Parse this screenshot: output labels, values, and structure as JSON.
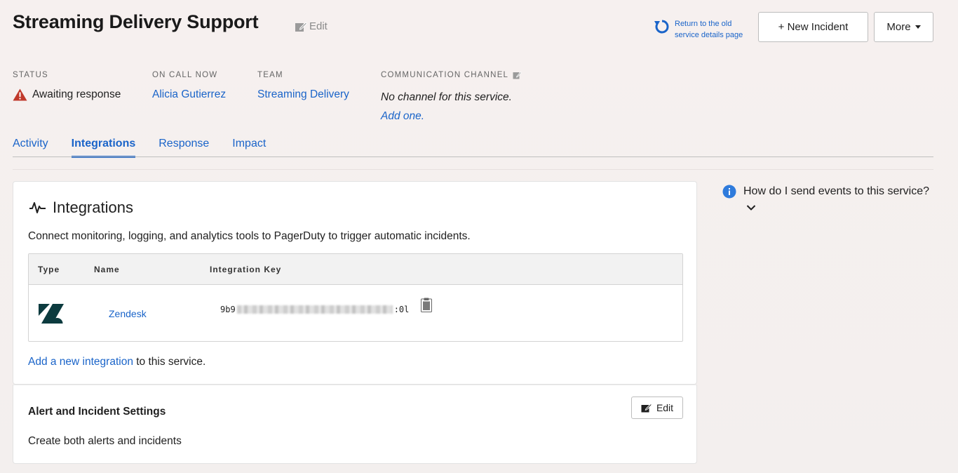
{
  "header": {
    "title": "Streaming Delivery Support",
    "edit_label": "Edit",
    "return_link_line1": "Return to the old",
    "return_link_line2": "service details page",
    "new_incident_label": "+ New Incident",
    "more_label": "More"
  },
  "meta": {
    "status_label": "STATUS",
    "status_value": "Awaiting response",
    "on_call_label": "ON CALL NOW",
    "on_call_value": "Alicia Gutierrez",
    "team_label": "TEAM",
    "team_value": "Streaming Delivery",
    "comm_label": "COMMUNICATION CHANNEL",
    "comm_none": "No channel for this service.",
    "comm_add": "Add one."
  },
  "tabs": [
    {
      "label": "Activity",
      "active": false
    },
    {
      "label": "Integrations",
      "active": true
    },
    {
      "label": "Response",
      "active": false
    },
    {
      "label": "Impact",
      "active": false
    }
  ],
  "integrations": {
    "title": "Integrations",
    "description": "Connect monitoring, logging, and analytics tools to PagerDuty to trigger automatic incidents.",
    "columns": [
      "Type",
      "Name",
      "Integration Key"
    ],
    "rows": [
      {
        "type_icon": "zendesk-logo-icon",
        "name": "Zendesk",
        "key_prefix": "9b9",
        "key_suffix": ":0l"
      }
    ],
    "add_link": "Add a new integration",
    "add_suffix": " to this service."
  },
  "alert_settings": {
    "title": "Alert and Incident Settings",
    "edit_label": "Edit",
    "description": "Create both alerts and incidents"
  },
  "help": {
    "text": "How do I send events to this service?"
  },
  "colors": {
    "link": "#1a64c9",
    "warning": "#c0392b",
    "info": "#2f7bdc"
  }
}
